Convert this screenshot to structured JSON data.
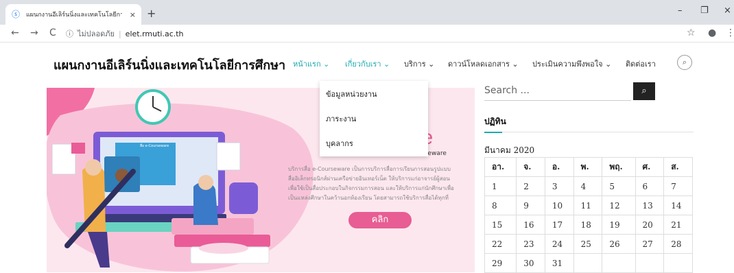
{
  "browser": {
    "tab_title": "แผนกงานอีเลิร์นนิ่งและเทคโนโลยีการศึกษา",
    "tab_close": "×",
    "new_tab": "+",
    "minimize": "–",
    "maximize": "❐",
    "close": "×",
    "back": "←",
    "forward": "→",
    "reload": "C",
    "insecure_label": "ไม่ปลอดภัย",
    "url": "elet.rmuti.ac.th",
    "star": "☆",
    "profile": "●",
    "more": "⋮"
  },
  "site": {
    "title": "แผนกงานอีเลิร์นนิ่งและเทคโนโลยีการศึกษา",
    "menu": [
      {
        "label": "หน้าแรก ⌄"
      },
      {
        "label": "เกี่ยวกับเรา ⌄"
      },
      {
        "label": "บริการ ⌄"
      },
      {
        "label": "ดาวน์โหลดเอกสาร ⌄"
      },
      {
        "label": "ประเมินความพึงพอใจ ⌄"
      },
      {
        "label": "ติดต่อเรา"
      }
    ],
    "search_icon": "🔍"
  },
  "dropdown": {
    "items": [
      "ข้อมูลหน่วยงาน",
      "ภาระงาน",
      "บุคลากร"
    ]
  },
  "banner": {
    "heading": "ระบบบริการสื่อ e-Courseware",
    "big_word": "are",
    "body": [
      "บริการสื่อ e-Courseware เป็นการบริการสื่อการเรียนการสอนรูปแบบ",
      "สื่ออิเล็กทรอนิกส์ผ่านเครือข่ายอินเทอร์เน็ต ให้บริการแก่อาจารย์ผู้สอน",
      "เพื่อใช้เป็นสื่อประกอบในกิจกรรมการสอน และให้บริการแก่นักศึกษาเพื่อ",
      "เป็นแหล่งศึกษาในคว้านอกห้องเรียน โดยสามารถใช้บริการสื่อได้ทุกที่"
    ],
    "button": "คลิก",
    "screen_text": "สื่อ e-Courseware"
  },
  "sidebar": {
    "search_placeholder": "Search ...",
    "search_button_icon": "🔍",
    "calendar_heading": "ปฏิทิน",
    "calendar_caption": "มีนาคม 2020",
    "weekdays": [
      "อา.",
      "จ.",
      "อ.",
      "พ.",
      "พฤ.",
      "ศ.",
      "ส."
    ],
    "weeks": [
      [
        "1",
        "2",
        "3",
        "4",
        "5",
        "6",
        "7"
      ],
      [
        "8",
        "9",
        "10",
        "11",
        "12",
        "13",
        "14"
      ],
      [
        "15",
        "16",
        "17",
        "18",
        "19",
        "20",
        "21"
      ],
      [
        "22",
        "23",
        "24",
        "25",
        "26",
        "27",
        "28"
      ],
      [
        "29",
        "30",
        "31",
        "",
        "",
        "",
        ""
      ]
    ]
  },
  "colors": {
    "accent": "#1eaab1",
    "banner_bg": "#fde7ee",
    "banner_pink": "#e85d93"
  }
}
